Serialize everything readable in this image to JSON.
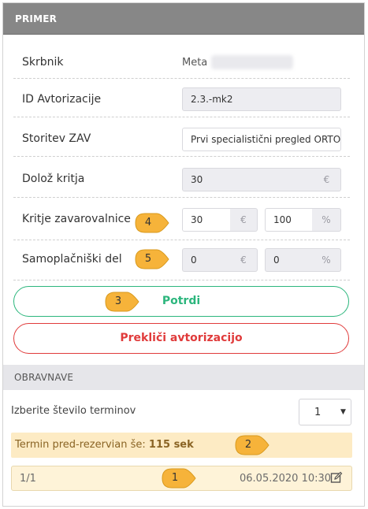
{
  "primer": {
    "title": "PRIMER",
    "skrbnik": {
      "label": "Skrbnik",
      "value": "Meta"
    },
    "id_avtorizacije": {
      "label": "ID Avtorizacije",
      "value": "2.3.-mk2"
    },
    "storitev": {
      "label": "Storitev ZAV",
      "value": "Prvi specialistični pregled ORTOPED"
    },
    "doloz_kritja": {
      "label": "Dolož kritja",
      "value": "30",
      "unit": "€"
    },
    "kritje": {
      "label": "Kritje zavarovalnice",
      "amount": "30",
      "amount_unit": "€",
      "percent": "100",
      "percent_unit": "%"
    },
    "samoplacniski": {
      "label": "Samoplačniški del",
      "amount": "0",
      "amount_unit": "€",
      "percent": "0",
      "percent_unit": "%"
    },
    "confirm_label": "Potrdi",
    "cancel_label": "Prekliči avtorizacijo"
  },
  "obravnave": {
    "title": "OBRAVNAVE",
    "count_label": "Izberite število terminov",
    "count_value": "1",
    "notice_prefix": "Termin pred-rezervian še:",
    "notice_value": "115 sek",
    "term": {
      "index": "1/1",
      "datetime": "06.05.2020 10:30"
    }
  },
  "markers": [
    "1",
    "2",
    "3",
    "4",
    "5"
  ],
  "colors": {
    "primer_header": "#878787",
    "confirm": "#2cb67d",
    "cancel": "#e03b3b",
    "marker": "#f6b33a",
    "notice_bg": "#fdebc4"
  },
  "icons": {
    "edit": "edit-icon",
    "caret": "chevron-down-icon"
  }
}
